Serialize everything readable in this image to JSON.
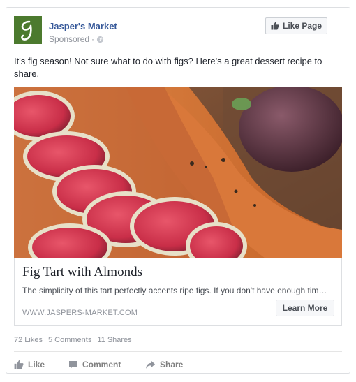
{
  "page": {
    "name": "Jasper's Market",
    "sponsored_label": "Sponsored",
    "separator": "·",
    "like_page_label": "Like Page",
    "avatar_letter": "J"
  },
  "post": {
    "text": "It's fig season! Not sure what to do with figs? Here's a great dessert recipe to share."
  },
  "link": {
    "title": "Fig Tart with Almonds",
    "description": "The simplicity of this tart perfectly accents ripe figs. If you don't have enough tim…",
    "domain": "WWW.JASPERS-MARKET.COM",
    "cta_label": "Learn More"
  },
  "stats": {
    "likes": "72 Likes",
    "comments": "5 Comments",
    "shares": "11 Shares"
  },
  "actions": {
    "like": "Like",
    "comment": "Comment",
    "share": "Share"
  },
  "colors": {
    "brand_green": "#4c7a2e",
    "link_blue": "#365899",
    "muted": "#90949c"
  }
}
